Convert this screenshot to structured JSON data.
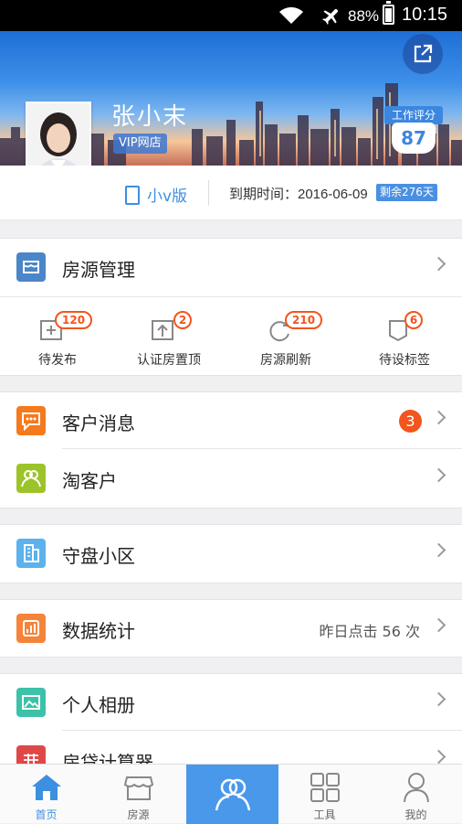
{
  "status_bar": {
    "battery": "88%",
    "time": "10:15"
  },
  "profile": {
    "name": "张小末",
    "shop_badge": "VIP网店",
    "score_label": "工作评分",
    "score": "87",
    "version": "小v版",
    "expire_text": "到期时间：2016-06-09",
    "remaining": "剩余276天"
  },
  "listings": {
    "title": "房源管理",
    "items": [
      {
        "label": "待发布",
        "count": "120",
        "icon": "add-listing-icon"
      },
      {
        "label": "认证房置顶",
        "count": "2",
        "icon": "upload-top-icon"
      },
      {
        "label": "房源刷新",
        "count": "210",
        "icon": "refresh-icon"
      },
      {
        "label": "待设标签",
        "count": "6",
        "icon": "tag-icon"
      }
    ]
  },
  "menu": {
    "messages": {
      "label": "客户消息",
      "badge": "3"
    },
    "leads": {
      "label": "淘客户"
    },
    "community": {
      "label": "守盘小区"
    },
    "stats": {
      "label": "数据统计",
      "extra": "昨日点击 56 次"
    },
    "album": {
      "label": "个人相册"
    },
    "calculator": {
      "label": "房贷计算器"
    }
  },
  "tabbar": {
    "home": "首页",
    "listings": "房源",
    "tools": "工具",
    "mine": "我的"
  },
  "colors": {
    "accent": "#3d8fe0",
    "badge": "#f2551d",
    "messages_icon": "#f57a1d",
    "leads_icon": "#9cc42a",
    "community_icon": "#5bb2ec",
    "stats_icon": "#f5843a",
    "album_icon": "#3cc2a8",
    "calculator_icon": "#e04848"
  }
}
